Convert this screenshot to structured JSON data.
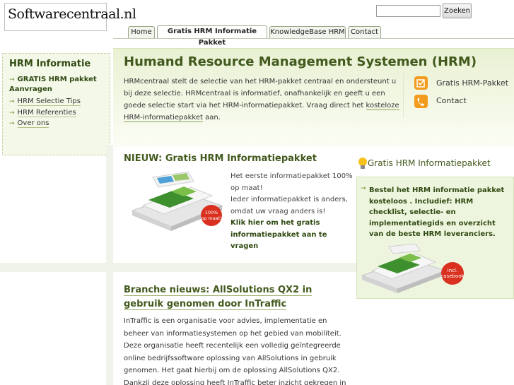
{
  "logo": {
    "text": "Softwarecentraal.nl"
  },
  "search": {
    "placeholder": "",
    "button_label": "Zoeken"
  },
  "nav": {
    "tabs": [
      {
        "label": "Home"
      },
      {
        "label": "Gratis HRM Informatie Pakket"
      },
      {
        "label": "KnowledgeBase HRM"
      },
      {
        "label": "Contact"
      }
    ]
  },
  "header": {
    "title": "Humand Resource Management Systemen (HRM)",
    "intro_part1": "HRMcentraal stelt de selectie van het HRM-pakket centraal en ondersteunt u bij deze selectie. HRMcentraal is informatief, onafhankelijk en geeft u een goede selectie start via het HRM-informatiepakket. Vraag direct het ",
    "intro_link": "kosteloze HRM-informatiepakket",
    "intro_part2": " aan.",
    "quick_links": [
      {
        "label": "Gratis HRM-Pakket",
        "icon": "checkbox-icon"
      },
      {
        "label": "Contact",
        "icon": "phone-icon"
      }
    ]
  },
  "sidebar": {
    "title": "HRM Informatie",
    "items": [
      {
        "label": "GRATIS HRM pakket Aanvragen"
      },
      {
        "label": "HRM Selectie Tips"
      },
      {
        "label": "HRM Referenties"
      },
      {
        "label": "Over ons"
      }
    ]
  },
  "news1": {
    "title": "NIEUW: Gratis HRM Informatiepakket",
    "line1": "Het eerste informatiepakket 100% op maat!",
    "line2": "Ieder informatiepakket is anders, omdat uw vraag anders is!",
    "link": "Klik hier om het gratis informatiepakket aan te vragen",
    "badge": "100% op maat!"
  },
  "news2": {
    "title": "Branche nieuws: AllSolutions QX2 in gebruik genomen door InTraffic",
    "body": "InTraffic is een organisatie voor advies, implementatie en beheer van informatiesystemen op het gebied van mobiliteit. Deze organisatie heeft recentelijk een volledig geïntegreerde online bedrijfssoftware oplossing van AllSolutions in gebruik genomen. Het gaat hierbij om de oplossing AllSolutions QX2. Dankzij deze oplossing heeft InTraffic beter inzicht gekregen in haar projecten"
  },
  "promo": {
    "title": "Gratis HRM Informatiepakket",
    "text": "Bestel het HRM informatie pakket kosteloos . Includief: HRM checklist, selectie- en implementatiegids en overzicht van de beste HRM leveranciers.",
    "badge": "incl. casebook"
  },
  "colors": {
    "brand_green": "#425a1d",
    "accent_orange": "#f29b1c",
    "badge_red": "#d9301f"
  }
}
